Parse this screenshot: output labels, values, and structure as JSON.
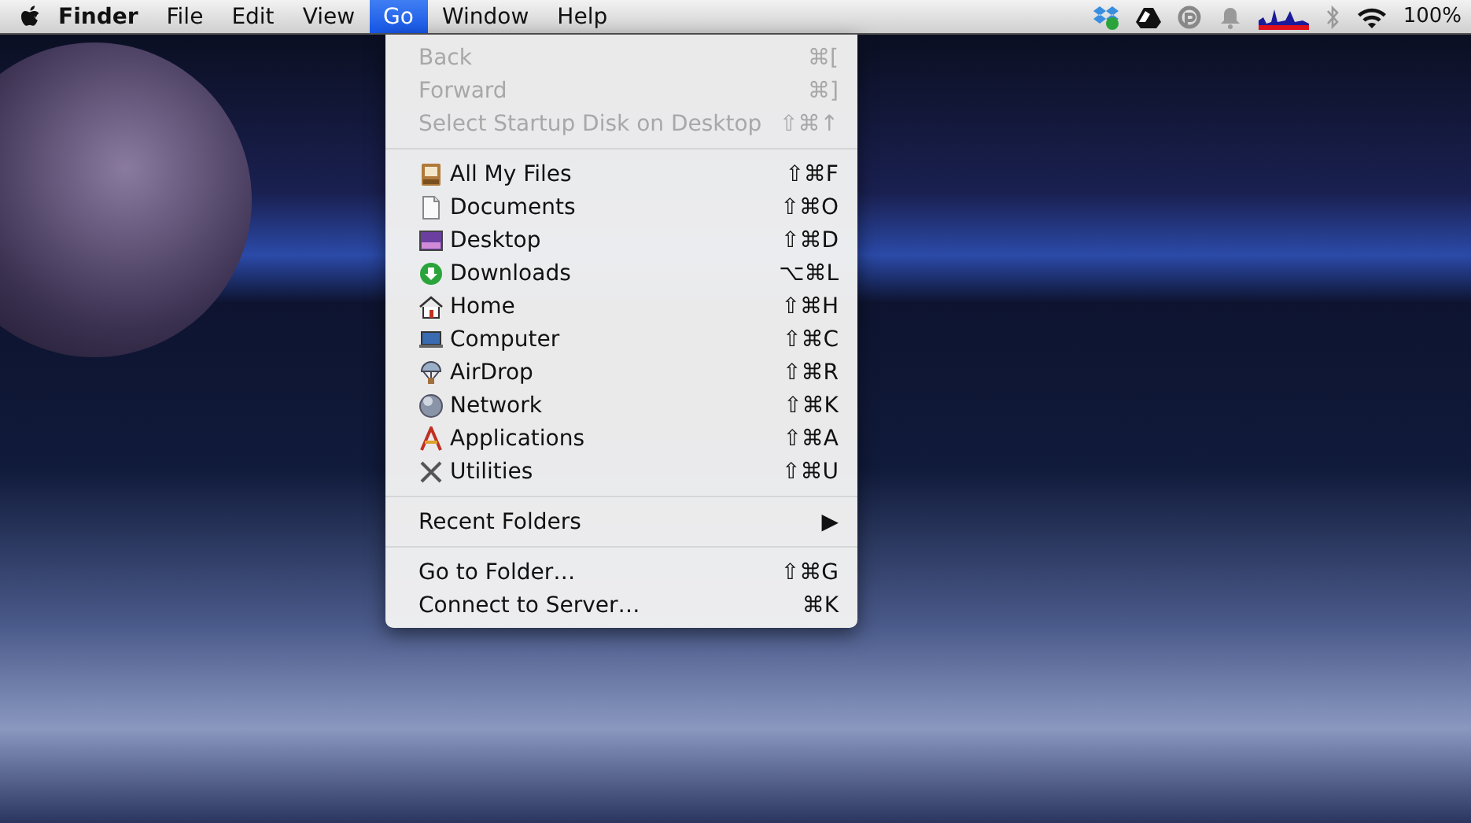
{
  "menu_bar": {
    "app_name": "Finder",
    "menus": [
      {
        "label": "File",
        "selected": false
      },
      {
        "label": "Edit",
        "selected": false
      },
      {
        "label": "View",
        "selected": false
      },
      {
        "label": "Go",
        "selected": true
      },
      {
        "label": "Window",
        "selected": false
      },
      {
        "label": "Help",
        "selected": false
      }
    ],
    "battery": "100%"
  },
  "go_menu": {
    "sections": [
      {
        "items": [
          {
            "label": "Back",
            "shortcut": "⌘[",
            "disabled": true
          },
          {
            "label": "Forward",
            "shortcut": "⌘]",
            "disabled": true
          },
          {
            "label": "Select Startup Disk on Desktop",
            "shortcut": "⇧⌘↑",
            "disabled": true
          }
        ]
      },
      {
        "items": [
          {
            "label": "All My Files",
            "shortcut": "⇧⌘F",
            "disabled": false,
            "kind": "files"
          },
          {
            "label": "Documents",
            "shortcut": "⇧⌘O",
            "disabled": false,
            "kind": "document"
          },
          {
            "label": "Desktop",
            "shortcut": "⇧⌘D",
            "disabled": false,
            "kind": "desktop"
          },
          {
            "label": "Downloads",
            "shortcut": "⌥⌘L",
            "disabled": false,
            "kind": "downloads"
          },
          {
            "label": "Home",
            "shortcut": "⇧⌘H",
            "disabled": false,
            "kind": "home"
          },
          {
            "label": "Computer",
            "shortcut": "⇧⌘C",
            "disabled": false,
            "kind": "computer"
          },
          {
            "label": "AirDrop",
            "shortcut": "⇧⌘R",
            "disabled": false,
            "kind": "airdrop"
          },
          {
            "label": "Network",
            "shortcut": "⇧⌘K",
            "disabled": false,
            "kind": "network"
          },
          {
            "label": "Applications",
            "shortcut": "⇧⌘A",
            "disabled": false,
            "kind": "applications"
          },
          {
            "label": "Utilities",
            "shortcut": "⇧⌘U",
            "disabled": false,
            "kind": "utilities"
          }
        ]
      },
      {
        "items": [
          {
            "label": "Recent Folders",
            "shortcut": "▶",
            "disabled": false
          }
        ]
      },
      {
        "items": [
          {
            "label": "Go to Folder…",
            "shortcut": "⇧⌘G",
            "disabled": false
          },
          {
            "label": "Connect to Server…",
            "shortcut": "⌘K",
            "disabled": false
          }
        ]
      }
    ]
  }
}
